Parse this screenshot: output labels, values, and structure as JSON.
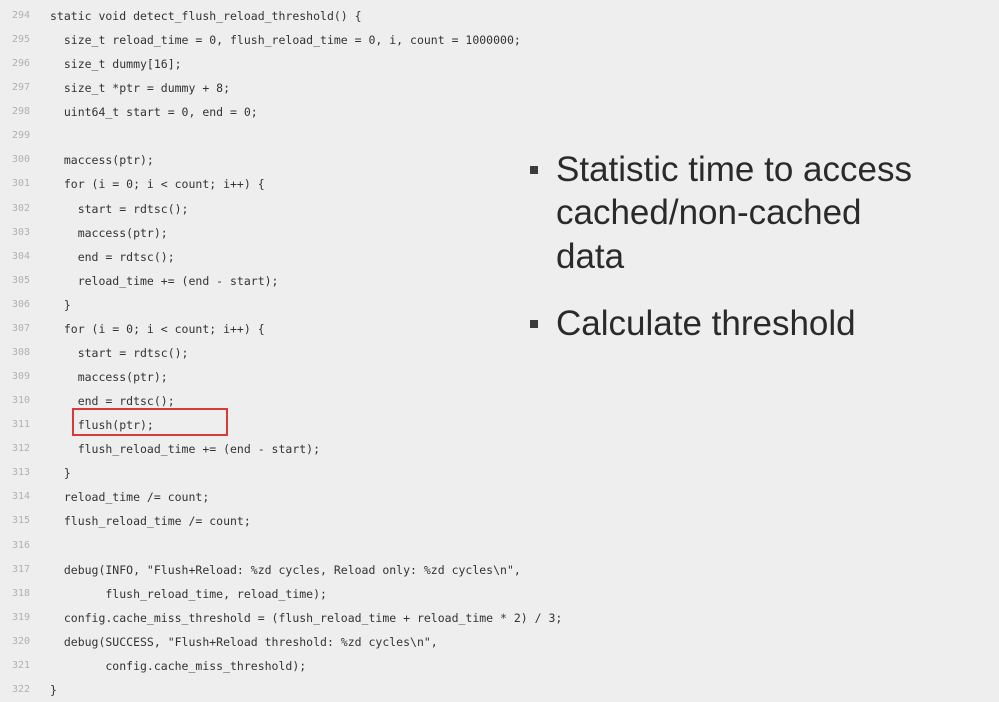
{
  "slide": {
    "bullets": [
      {
        "lines": [
          "Statistic time to access",
          "cached/non-cached",
          "data"
        ]
      },
      {
        "lines": [
          "Calculate threshold"
        ]
      }
    ]
  },
  "code": {
    "lines": [
      {
        "n": "294",
        "text": "static void detect_flush_reload_threshold() {"
      },
      {
        "n": "295",
        "text": "  size_t reload_time = 0, flush_reload_time = 0, i, count = 1000000;"
      },
      {
        "n": "296",
        "text": "  size_t dummy[16];"
      },
      {
        "n": "297",
        "text": "  size_t *ptr = dummy + 8;"
      },
      {
        "n": "298",
        "text": "  uint64_t start = 0, end = 0;"
      },
      {
        "n": "299",
        "text": ""
      },
      {
        "n": "300",
        "text": "  maccess(ptr);"
      },
      {
        "n": "301",
        "text": "  for (i = 0; i < count; i++) {"
      },
      {
        "n": "302",
        "text": "    start = rdtsc();"
      },
      {
        "n": "303",
        "text": "    maccess(ptr);"
      },
      {
        "n": "304",
        "text": "    end = rdtsc();"
      },
      {
        "n": "305",
        "text": "    reload_time += (end - start);"
      },
      {
        "n": "306",
        "text": "  }"
      },
      {
        "n": "307",
        "text": "  for (i = 0; i < count; i++) {"
      },
      {
        "n": "308",
        "text": "    start = rdtsc();"
      },
      {
        "n": "309",
        "text": "    maccess(ptr);"
      },
      {
        "n": "310",
        "text": "    end = rdtsc();"
      },
      {
        "n": "311",
        "text": "    flush(ptr);"
      },
      {
        "n": "312",
        "text": "    flush_reload_time += (end - start);"
      },
      {
        "n": "313",
        "text": "  }"
      },
      {
        "n": "314",
        "text": "  reload_time /= count;"
      },
      {
        "n": "315",
        "text": "  flush_reload_time /= count;"
      },
      {
        "n": "316",
        "text": ""
      },
      {
        "n": "317",
        "text": "  debug(INFO, \"Flush+Reload: %zd cycles, Reload only: %zd cycles\\n\","
      },
      {
        "n": "318",
        "text": "        flush_reload_time, reload_time);"
      },
      {
        "n": "319",
        "text": "  config.cache_miss_threshold = (flush_reload_time + reload_time * 2) / 3;"
      },
      {
        "n": "320",
        "text": "  debug(SUCCESS, \"Flush+Reload threshold: %zd cycles\\n\","
      },
      {
        "n": "321",
        "text": "        config.cache_miss_threshold);"
      },
      {
        "n": "322",
        "text": "}"
      }
    ]
  }
}
